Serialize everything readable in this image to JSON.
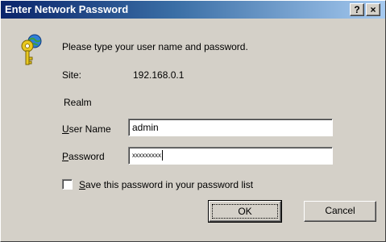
{
  "window": {
    "title": "Enter Network Password",
    "help_button": "?",
    "close_button": "×"
  },
  "icon": "key-icon",
  "prompt": "Please type your user name and password.",
  "site": {
    "label": "Site:",
    "value": "192.168.0.1"
  },
  "realm": {
    "label": "Realm",
    "value": ""
  },
  "username": {
    "label_accel": "U",
    "label_rest": "ser Name",
    "value": "admin"
  },
  "password": {
    "label_accel": "P",
    "label_rest": "assword",
    "value": "xxxxxxxxx"
  },
  "save_password": {
    "label_accel": "S",
    "label_rest": "ave this password in your password list",
    "checked": false
  },
  "buttons": {
    "ok": "OK",
    "cancel": "Cancel"
  }
}
